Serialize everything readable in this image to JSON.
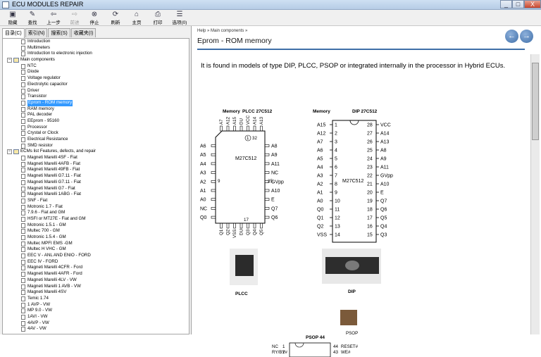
{
  "window": {
    "title": "ECU MODULES REPAIR",
    "min": "_",
    "max": "□",
    "close": "X"
  },
  "toolbar": [
    {
      "label": "隐藏",
      "icon": "hide-icon",
      "enabled": true
    },
    {
      "label": "查找",
      "icon": "find-icon",
      "enabled": true
    },
    {
      "label": "上一步",
      "icon": "back-icon",
      "enabled": true
    },
    {
      "label": "前进",
      "icon": "forward-icon",
      "enabled": false
    },
    {
      "label": "停止",
      "icon": "stop-icon",
      "enabled": true
    },
    {
      "label": "刷新",
      "icon": "refresh-icon",
      "enabled": true
    },
    {
      "label": "主页",
      "icon": "home-icon",
      "enabled": true
    },
    {
      "label": "打印",
      "icon": "print-icon",
      "enabled": true
    },
    {
      "label": "选项(0)",
      "icon": "options-icon",
      "enabled": true
    }
  ],
  "tabs": [
    "目录(C)",
    "索引(N)",
    "搜索(S)",
    "收藏夹(I)"
  ],
  "tree": [
    {
      "label": "Introduction",
      "level": 1,
      "type": "page"
    },
    {
      "label": "Multimeters",
      "level": 1,
      "type": "page"
    },
    {
      "label": "Introduction to electronic injection",
      "level": 1,
      "type": "page"
    },
    {
      "label": "Main components",
      "level": 0,
      "type": "book"
    },
    {
      "label": "NTC",
      "level": 1,
      "type": "page"
    },
    {
      "label": "Diode",
      "level": 1,
      "type": "page"
    },
    {
      "label": "Voltage regulator",
      "level": 1,
      "type": "page"
    },
    {
      "label": "Electrolytic capacitor",
      "level": 1,
      "type": "page"
    },
    {
      "label": "Driver",
      "level": 1,
      "type": "page"
    },
    {
      "label": "Transistor",
      "level": 1,
      "type": "page"
    },
    {
      "label": "Eprom - ROM memory",
      "level": 1,
      "type": "page",
      "selected": true
    },
    {
      "label": "RAM memory",
      "level": 1,
      "type": "page"
    },
    {
      "label": "PAL decoder",
      "level": 1,
      "type": "page"
    },
    {
      "label": "EEprom - 95160",
      "level": 1,
      "type": "page"
    },
    {
      "label": "Processor",
      "level": 1,
      "type": "page"
    },
    {
      "label": "Crystal or Clock",
      "level": 1,
      "type": "page"
    },
    {
      "label": "Electrical Resistance",
      "level": 1,
      "type": "page"
    },
    {
      "label": "SMD resistor",
      "level": 1,
      "type": "page"
    },
    {
      "label": "ECMs list Features, defects, and repair",
      "level": 0,
      "type": "book"
    },
    {
      "label": "Magneti Marelli 4SF - Fiat",
      "level": 1,
      "type": "page"
    },
    {
      "label": "Magneti Marelli 4AFB - Fiat",
      "level": 1,
      "type": "page"
    },
    {
      "label": "Magneti Marelli 49FB - Fiat",
      "level": 1,
      "type": "page"
    },
    {
      "label": "Magneti Marelli G7.11 - Fiat",
      "level": 1,
      "type": "page"
    },
    {
      "label": "Magneti Marelli G7.11 - Fiat",
      "level": 1,
      "type": "page"
    },
    {
      "label": "Magneti Marelli G7 - Fiat",
      "level": 1,
      "type": "page"
    },
    {
      "label": "Magneti Marelli 1ABG - Fiat",
      "level": 1,
      "type": "page"
    },
    {
      "label": "SNF - Fiat",
      "level": 1,
      "type": "page"
    },
    {
      "label": "Motronic 1.7 - Fiat",
      "level": 1,
      "type": "page"
    },
    {
      "label": "7.9.6 - Fiat and GM",
      "level": 1,
      "type": "page"
    },
    {
      "label": "HSFI or MT27E - Fiat and GM",
      "level": 1,
      "type": "page"
    },
    {
      "label": "Motronic 1.5.1 - GM",
      "level": 1,
      "type": "page"
    },
    {
      "label": "Multec 700 - GM",
      "level": 1,
      "type": "page"
    },
    {
      "label": "Motronic 1.5.4 - GM",
      "level": 1,
      "type": "page"
    },
    {
      "label": "Multec MPFI EMS -GM",
      "level": 1,
      "type": "page"
    },
    {
      "label": "Multec H VHC - GM",
      "level": 1,
      "type": "page"
    },
    {
      "label": "EEC V - ANL AND ENIO - FORD",
      "level": 1,
      "type": "page"
    },
    {
      "label": "EEC IV - FORD",
      "level": 1,
      "type": "page"
    },
    {
      "label": "Magneti Marelli 4CFR - Ford",
      "level": 1,
      "type": "page"
    },
    {
      "label": "Magneti Marelli 4AFR - Ford",
      "level": 1,
      "type": "page"
    },
    {
      "label": "Magneti Marelli 4LV - VW",
      "level": 1,
      "type": "page"
    },
    {
      "label": "Magneti Marelli 1 AVB - VW",
      "level": 1,
      "type": "page"
    },
    {
      "label": "Magneti Marelli 4SV",
      "level": 1,
      "type": "page"
    },
    {
      "label": "Temic 1.74",
      "level": 1,
      "type": "page"
    },
    {
      "label": "1 AVP - VW",
      "level": 1,
      "type": "page"
    },
    {
      "label": "MP 9.0 - VW",
      "level": 1,
      "type": "page"
    },
    {
      "label": "1AVI - VW",
      "level": 1,
      "type": "page"
    },
    {
      "label": "4AVP - VW",
      "level": 1,
      "type": "page"
    },
    {
      "label": "4AV - VW",
      "level": 1,
      "type": "page"
    }
  ],
  "content": {
    "breadcrumb": "Help » Main components »",
    "title": "Eprom - ROM memory",
    "text": "It is found in models of type DIP, PLCC, PSOP or integrated internally in the processor in Hybrid ECUs.",
    "plcc": {
      "header_a": "Memory",
      "header_b": "PLCC 27C512",
      "chip": "M27C512",
      "caption": "PLCC",
      "pin1": "1",
      "pin32": "32",
      "pin9": "9",
      "pin25": "25",
      "pin17": "17",
      "top": [
        "A7",
        "A12",
        "A15",
        "DU",
        "VCC",
        "A14",
        "A13"
      ],
      "left": [
        "A6",
        "A5",
        "A4",
        "A3",
        "A2",
        "A1",
        "A0",
        "NC",
        "Q0"
      ],
      "right": [
        "A8",
        "A9",
        "A11",
        "NC",
        "GVpp",
        "A10",
        "E",
        "Q7",
        "Q6"
      ],
      "bottom": [
        "Q1",
        "Q2",
        "VSS",
        "DU",
        "Q3",
        "Q4",
        "Q5"
      ]
    },
    "dip": {
      "header_a": "Memory",
      "header_b": "DIP 27C512",
      "chip": "M27C512",
      "caption": "DIP",
      "left": [
        "A15",
        "A12",
        "A7",
        "A6",
        "A5",
        "A4",
        "A3",
        "A2",
        "A1",
        "A0",
        "Q0",
        "Q1",
        "Q2",
        "VSS"
      ],
      "right": [
        "VCC",
        "A14",
        "A13",
        "A8",
        "A9",
        "A11",
        "GVpp",
        "A10",
        "E",
        "Q7",
        "Q6",
        "Q5",
        "Q4",
        "Q3"
      ],
      "lnum": [
        "1",
        "2",
        "3",
        "4",
        "5",
        "6",
        "7",
        "8",
        "9",
        "10",
        "11",
        "12",
        "13",
        "14"
      ],
      "rnum": [
        "28",
        "27",
        "26",
        "25",
        "24",
        "23",
        "22",
        "21",
        "20",
        "19",
        "18",
        "17",
        "16",
        "15"
      ]
    },
    "psop": {
      "caption": "PSOP",
      "header": "PSOP 44",
      "rows": [
        {
          "ln": "NC",
          "lp": "1",
          "rp": "44",
          "rn": "RESET#"
        },
        {
          "ln": "RY/BY#",
          "lp": "2",
          "rp": "43",
          "rn": "WE#"
        }
      ]
    }
  }
}
